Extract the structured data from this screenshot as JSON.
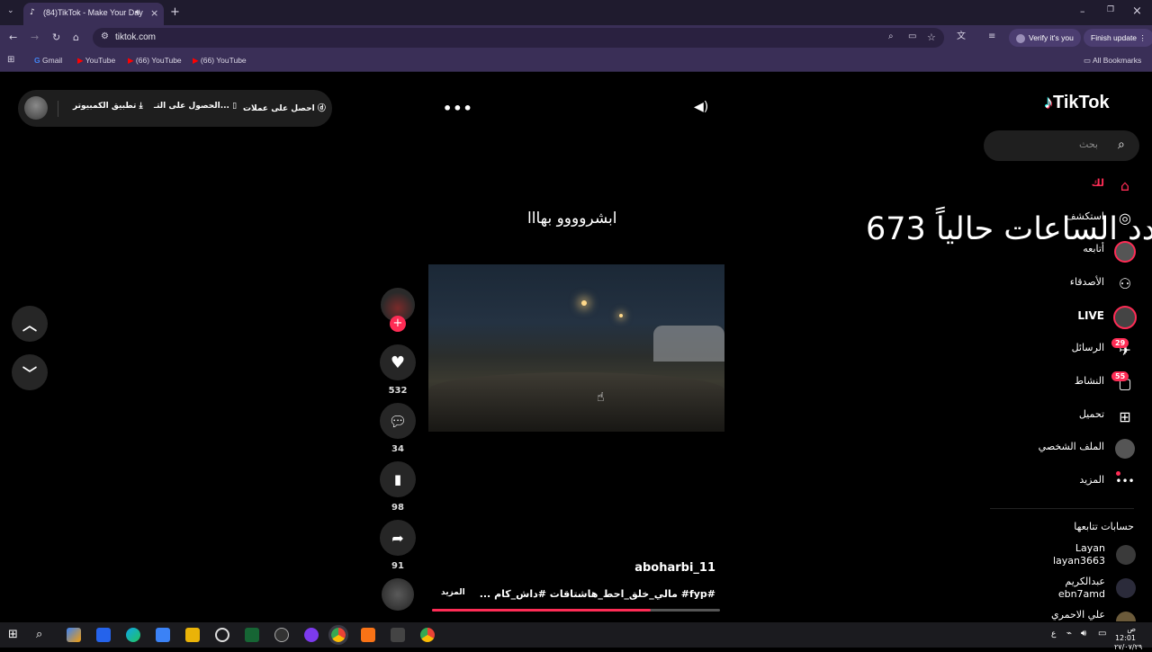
{
  "browser": {
    "tab_title": "(84)TikTok - Make Your Day",
    "url": "tiktok.com",
    "verify_label": "Verify it's you",
    "finish_update_label": "Finish update",
    "bookmarks": [
      "Gmail",
      "YouTube",
      "(66) YouTube",
      "(66) YouTube"
    ],
    "all_bookmarks": "All Bookmarks"
  },
  "topbar": {
    "get_coins": "احصل على عملات",
    "get_app": "الحصول على التـ...",
    "desktop_app": "تطبيق الكمبيوتر"
  },
  "brand": {
    "logo_text": "TikTok"
  },
  "search": {
    "placeholder": "بحث"
  },
  "overlay_text": "عدد الساعات حالياً 673",
  "nav": {
    "for_you": "لك",
    "explore": "استكشف",
    "following": "أتابعه",
    "friends": "الأصدقاء",
    "live": "LIVE",
    "messages": "الرسائل",
    "messages_badge": "29",
    "activity": "النشاط",
    "activity_badge": "55",
    "upload": "تحميل",
    "profile": "الملف الشخصي",
    "more": "المزيد"
  },
  "following_accounts": {
    "title": "حسابات تتابعها",
    "items": [
      {
        "name": "Layan",
        "handle": "layan3663"
      },
      {
        "name": "عبدالكريم",
        "handle": "ebn7amd"
      },
      {
        "name": "علي الاحمري",
        "handle": ""
      }
    ]
  },
  "video": {
    "caption": "ابشروووو بهااا",
    "author": "aboharbi_11",
    "description": "#fyp# مالي_خلق_احط_هاشتاقات #داش_كام ...",
    "more": "المزيد",
    "progress": 0.76
  },
  "actions": {
    "likes": "532",
    "comments": "34",
    "saves": "98",
    "shares": "91"
  },
  "system": {
    "time": "12:01",
    "ampm": "ص",
    "date": "٢٧/٠٧/٢٩",
    "lang": "ع"
  },
  "colors": {
    "accent": "#fe2c55",
    "browser_frame": "#3a2f57",
    "page_bg": "#000000"
  }
}
